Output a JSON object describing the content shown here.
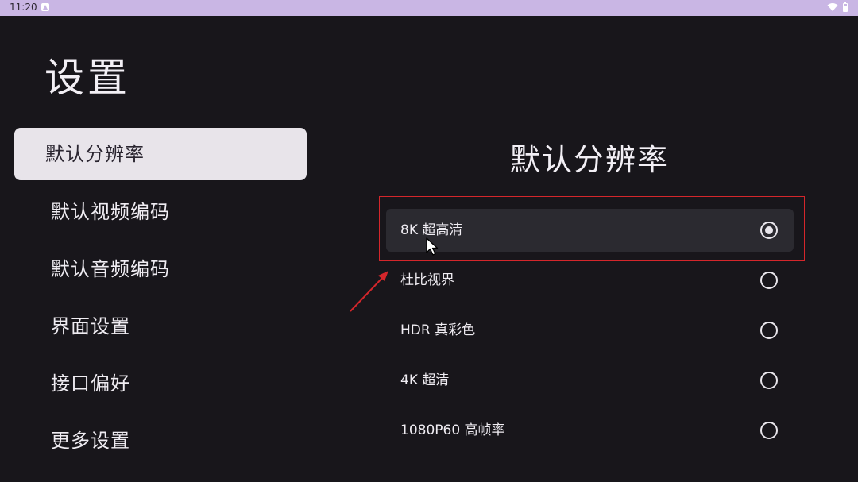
{
  "status_bar": {
    "time": "11:20"
  },
  "page": {
    "title": "设置"
  },
  "sidebar": {
    "items": [
      {
        "label": "默认分辨率",
        "selected": true
      },
      {
        "label": "默认视频编码",
        "selected": false
      },
      {
        "label": "默认音频编码",
        "selected": false
      },
      {
        "label": "界面设置",
        "selected": false
      },
      {
        "label": "接口偏好",
        "selected": false
      },
      {
        "label": "更多设置",
        "selected": false
      }
    ]
  },
  "panel": {
    "title": "默认分辨率",
    "options": [
      {
        "label": "8K 超高清",
        "checked": true
      },
      {
        "label": "杜比视界",
        "checked": false
      },
      {
        "label": "HDR 真彩色",
        "checked": false
      },
      {
        "label": "4K 超清",
        "checked": false
      },
      {
        "label": "1080P60 高帧率",
        "checked": false
      }
    ]
  },
  "colors": {
    "background": "#18161b",
    "status_bar": "#c9b6e4",
    "selected_item_bg": "#e8e4ea",
    "focused_option_bg": "#2b2a30",
    "annotation_red": "#d4262b"
  },
  "icons": [
    "wifi-icon",
    "battery-icon",
    "radio-icon",
    "annotation-arrow",
    "mouse-cursor"
  ]
}
